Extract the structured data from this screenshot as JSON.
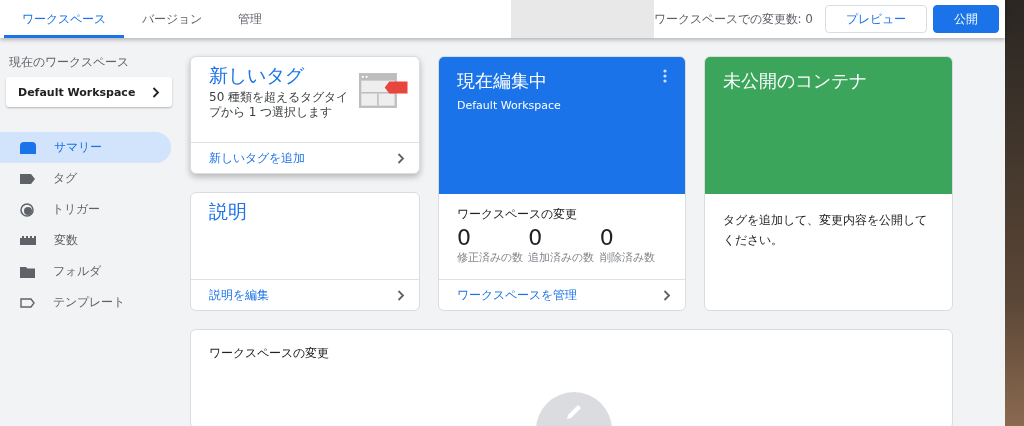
{
  "top_bar": {
    "tabs": [
      {
        "label": "ワークスペース",
        "selected": true
      },
      {
        "label": "バージョン",
        "selected": false
      },
      {
        "label": "管理",
        "selected": false
      }
    ],
    "changes_count": "ワークスペースでの変更数: 0",
    "preview_button": "プレビュー",
    "publish_button": "公開"
  },
  "sidebar": {
    "current_workspace_label": "現在のワークスペース",
    "workspace": "Default Workspace",
    "items": [
      {
        "label": "サマリー",
        "selected": true
      },
      {
        "label": "タグ",
        "selected": false
      },
      {
        "label": "トリガー",
        "selected": false
      },
      {
        "label": "変数",
        "selected": false
      },
      {
        "label": "フォルダ",
        "selected": false
      },
      {
        "label": "テンプレート",
        "selected": false
      }
    ]
  },
  "new_tag_card": {
    "title": "新しいタグ",
    "description": "50 種類を超えるタグタイプから 1 つ選択します",
    "link": "新しいタグを追加"
  },
  "description_card": {
    "title": "説明",
    "link": "説明を編集"
  },
  "editing_card": {
    "title": "現在編集中",
    "workspace": "Default Workspace",
    "changes_title": "ワークスペースの変更",
    "stats": [
      {
        "value": "0",
        "label": "修正済みの数"
      },
      {
        "value": "0",
        "label": "追加済みの数"
      },
      {
        "value": "0",
        "label": "削除済み数"
      }
    ],
    "link": "ワークスペースを管理"
  },
  "unpublished_card": {
    "title": "未公開のコンテナ",
    "message": "タグを追加して、変更内容を公開してください。"
  },
  "workspace_changes_card": {
    "title": "ワークスペースの変更"
  }
}
